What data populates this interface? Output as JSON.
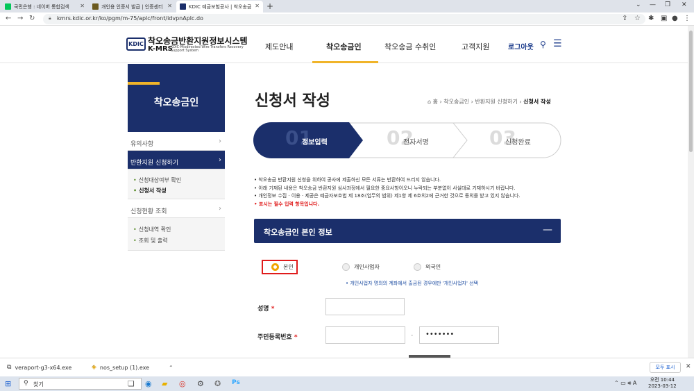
{
  "browser": {
    "tabs": [
      {
        "title": "국민은행 : 네이버 통합검색",
        "fav_color": "#03c75a"
      },
      {
        "title": "개인용 인증서 발급 | 인증센터",
        "fav_color": "#6b5a1e"
      },
      {
        "title": "KDIC 예금보험공사 | 착오송금",
        "fav_color": "#1b2f6b"
      }
    ],
    "url": "kmrs.kdic.or.kr/ko/pgm/m-75/aplc/front/idvpnAplc.do"
  },
  "site": {
    "logo_badge": "KDIC",
    "logo_kr": "착오송금반환지원정보시스템",
    "logo_en": "K-MRS",
    "logo_sub": "KDIC-Misdirected Wire Transfers Recovery Support System",
    "nav": [
      "제도안내",
      "착오송금인",
      "착오송금 수취인",
      "고객지원"
    ],
    "logout": "로그아웃"
  },
  "sidebar": {
    "title": "착오송금인",
    "menu1": "유의사항",
    "menu2": "반환지원 신청하기",
    "sub2": [
      "신청대상여부 확인",
      "신청서 작성"
    ],
    "menu3": "신청현황 조회",
    "sub3": [
      "신청내역 확인",
      "조회 및 출력"
    ]
  },
  "main": {
    "title": "신청서 작성",
    "breadcrumb": [
      "홈",
      "착오송금인",
      "반환지원 신청하기",
      "신청서 작성"
    ],
    "steps": [
      {
        "num": "01",
        "label": "정보입력"
      },
      {
        "num": "02",
        "label": "전자서명"
      },
      {
        "num": "03",
        "label": "신청완료"
      }
    ],
    "notes": [
      "• 착오송금 반환지원 신청을 위하여 공사에 제출하신 모든 서류는 반환하여 드리지 않습니다.",
      "• 아래 기재된 내용은 착오송금 반환지원 심사과정에서 필요한 중요사항이오니 누락되는 부분없이 사실대로 기재하시기 바랍니다.",
      "• 개인정보 수집 · 이용 · 제공은 예금자보호법 제 18조(업무의 범위) 제1항 제 6호의2에 근거한 것으로 동의를 받고 있지 않습니다."
    ],
    "req_note": "• 표시는 필수 입력 항목입니다.",
    "section_title": "착오송금인 본인 정보",
    "section_toggle": "—",
    "radios": [
      "본인",
      "개인사업자",
      "외국인"
    ],
    "type_note": "• 개인사업자 명의의 계좌에서 출금된 경우에만 '개인사업자' 선택",
    "name_label": "성명",
    "rrn_label": "주민등록번호",
    "required_mark": "*",
    "rrn_back": "•••••••",
    "rrn_dash": "-"
  },
  "downloads": [
    {
      "name": "veraport-g3-x64.exe"
    },
    {
      "name": "nos_setup (1).exe"
    }
  ],
  "downloads_show_all": "모두 표시",
  "taskbar": {
    "search": "찾기",
    "time": "오전 10:44",
    "date": "2023-03-12"
  }
}
